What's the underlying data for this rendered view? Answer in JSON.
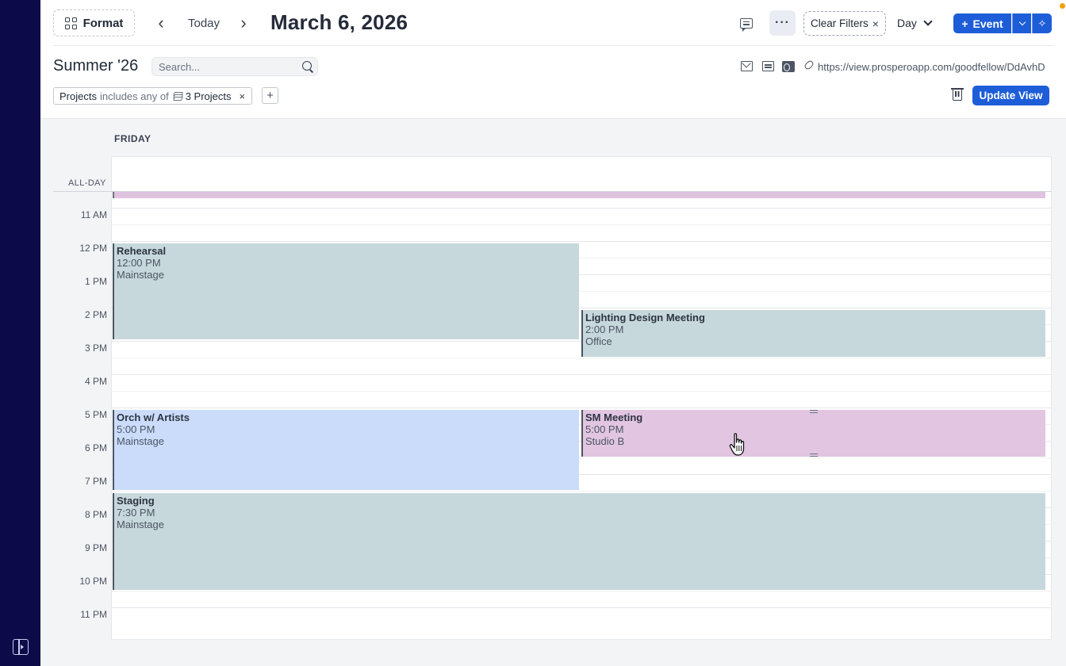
{
  "toolbar": {
    "format_label": "Format",
    "today_label": "Today",
    "date_title": "March 6, 2026",
    "more_label": "···",
    "clear_filters_label": "Clear Filters",
    "clear_filters_x": "×",
    "view_mode": "Day",
    "add_event_label": "Event",
    "prev_glyph": "‹",
    "next_glyph": "›",
    "plus_glyph": "+",
    "sparkle_glyph": "✧"
  },
  "view": {
    "title": "Summer '26",
    "search_placeholder": "Search...",
    "share_url": "https://view.prosperoapp.com/goodfellow/DdAvhD",
    "update_view_label": "Update View"
  },
  "filters": {
    "chip": {
      "field": "Projects",
      "operator": "includes any of",
      "value": "3 Projects",
      "remove_glyph": "×"
    },
    "add_glyph": "+"
  },
  "calendar": {
    "day_label": "FRIDAY",
    "allday_label": "ALL-DAY",
    "hours": [
      "11 AM",
      "12 PM",
      "1 PM",
      "2 PM",
      "3 PM",
      "4 PM",
      "5 PM",
      "6 PM",
      "7 PM",
      "8 PM",
      "9 PM",
      "10 PM",
      "11 PM"
    ],
    "events": [
      {
        "title": "Rehearsal",
        "time": "12:00 PM",
        "location": "Mainstage",
        "color": "#c7d8dc"
      },
      {
        "title": "Lighting Design Meeting",
        "time": "2:00 PM",
        "location": "Office",
        "color": "#c7d8dc"
      },
      {
        "title": "Orch w/ Artists",
        "time": "5:00 PM",
        "location": "Mainstage",
        "color": "#cbdcfb"
      },
      {
        "title": "SM Meeting",
        "time": "5:00 PM",
        "location": "Studio B",
        "color": "#e2c5e1"
      },
      {
        "title": "Staging",
        "time": "7:30 PM",
        "location": "Mainstage",
        "color": "#c7d8dc"
      }
    ]
  },
  "colors": {
    "sidebar": "#0d0a4a",
    "accent": "#1d5ed8",
    "allday_event": "#dfc2e0",
    "notification": "#f59e0b"
  }
}
